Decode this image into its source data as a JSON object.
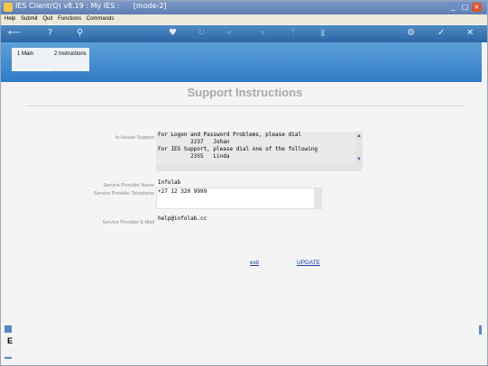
{
  "window": {
    "title": "IES Client(Q) v8.19 : My IES :      [mode-2]",
    "controls": [
      "_",
      "□",
      "×"
    ]
  },
  "menu": {
    "items": [
      "Help",
      "Submit",
      "Quit",
      "Functions",
      "Commands"
    ]
  },
  "toolbar": {
    "icons": [
      "back-arrow-icon",
      "help-icon",
      "search-icon",
      "heart-icon",
      "refresh-icon",
      "rewind-icon",
      "fast-forward-icon",
      "export-icon",
      "save-icon",
      "settings-icon",
      "ok-icon",
      "close-icon"
    ]
  },
  "tabs": [
    {
      "label": "1 Main"
    },
    {
      "label": "2 Instructions"
    }
  ],
  "page": {
    "title": "Support Instructions"
  },
  "form": {
    "in_house_label": "In-House Support",
    "in_house_text": "For Logon and Password Problems, please dial\n          2237   Johan\nFor IES Support, please dial one of the following\n          2355   Linda",
    "provider_name_label": "Service Provider Name",
    "provider_name_value": "Infolab",
    "provider_phone_label": "Service Provider Telephone",
    "provider_phone_value": "+27 12 320 9999",
    "provider_email_label": "Service Provider E-Mail",
    "provider_email_value": "help@infolab.cc"
  },
  "actions": {
    "exit_label": "exit",
    "update_label": "UPDATE"
  },
  "colors": {
    "title_bar": "#5c7db3",
    "toolbar": "#2a64a5",
    "tab_band": "#2f7bc6",
    "page_title": "#a9a9a9",
    "link": "#1a3da8"
  },
  "sidebar": {
    "letter": "E"
  }
}
